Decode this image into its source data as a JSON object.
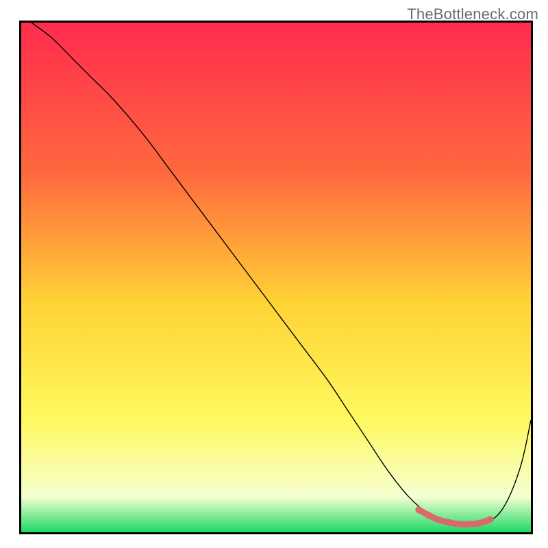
{
  "attribution": "TheBottleneck.com",
  "chart_data": {
    "type": "line",
    "title": "",
    "xlabel": "",
    "ylabel": "",
    "xlim": [
      0,
      100
    ],
    "ylim": [
      0,
      100
    ],
    "grid": false,
    "legend": false,
    "background_gradient": {
      "top_color": "#ff2b4e",
      "upper_mid_color": "#ff6a3e",
      "mid_color": "#ffd335",
      "lower_mid_color": "#fff95f",
      "near_bottom_color": "#f6ffd1",
      "bottom_color": "#1cd964"
    },
    "series": [
      {
        "name": "curve",
        "color": "#000000",
        "width": 1.4,
        "x": [
          2,
          6,
          10,
          14,
          18,
          24,
          30,
          36,
          42,
          48,
          54,
          60,
          64,
          68,
          72,
          76,
          80,
          83,
          86,
          89,
          92,
          95,
          98,
          100
        ],
        "y": [
          100,
          97,
          93,
          89,
          85,
          78,
          70,
          62,
          54,
          46,
          38,
          30,
          24,
          18,
          12,
          7,
          3.5,
          2,
          1.6,
          1.6,
          2.2,
          5.5,
          13,
          22
        ]
      },
      {
        "name": "highlight",
        "color": "#d86a6a",
        "width": 9,
        "marker_radius": 5,
        "x": [
          78,
          80,
          82,
          84,
          86,
          88,
          90,
          92
        ],
        "y": [
          4.4,
          3.3,
          2.4,
          1.9,
          1.6,
          1.6,
          1.8,
          2.5
        ]
      }
    ]
  }
}
